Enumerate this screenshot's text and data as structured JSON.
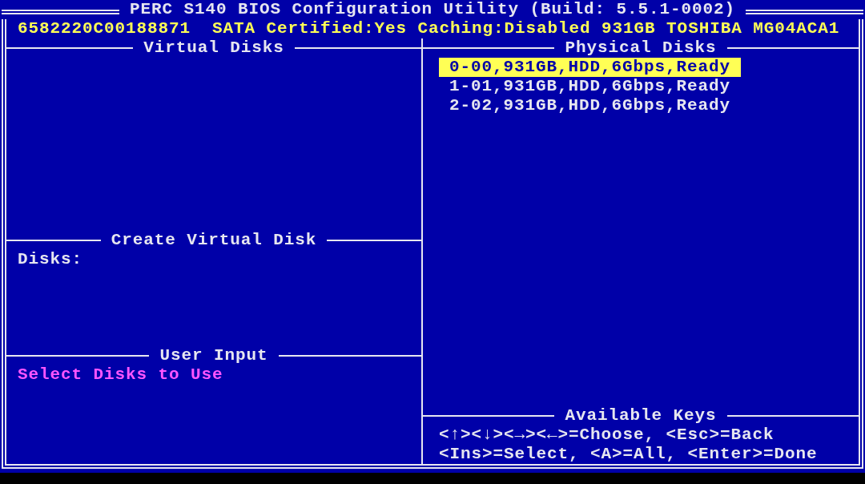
{
  "title": "PERC S140 BIOS Configuration Utility (Build: 5.5.1-0002)",
  "info": "6582220C00188871  SATA Certified:Yes Caching:Disabled 931GB TOSHIBA MG04ACA1",
  "virtual_disks": {
    "heading": "Virtual Disks"
  },
  "create_virtual_disk": {
    "heading": "Create Virtual Disk",
    "disks_label": "Disks:"
  },
  "user_input": {
    "heading": "User Input",
    "prompt": "Select Disks to Use"
  },
  "physical_disks": {
    "heading": "Physical Disks",
    "items": [
      {
        "label": "0-00,931GB,HDD,6Gbps,Ready",
        "selected": true
      },
      {
        "label": "1-01,931GB,HDD,6Gbps,Ready",
        "selected": false
      },
      {
        "label": "2-02,931GB,HDD,6Gbps,Ready",
        "selected": false
      }
    ]
  },
  "available_keys": {
    "heading": "Available Keys",
    "lines": [
      "<↑><↓><→><←>=Choose, <Esc>=Back",
      "<Ins>=Select, <A>=All, <Enter>=Done"
    ]
  }
}
